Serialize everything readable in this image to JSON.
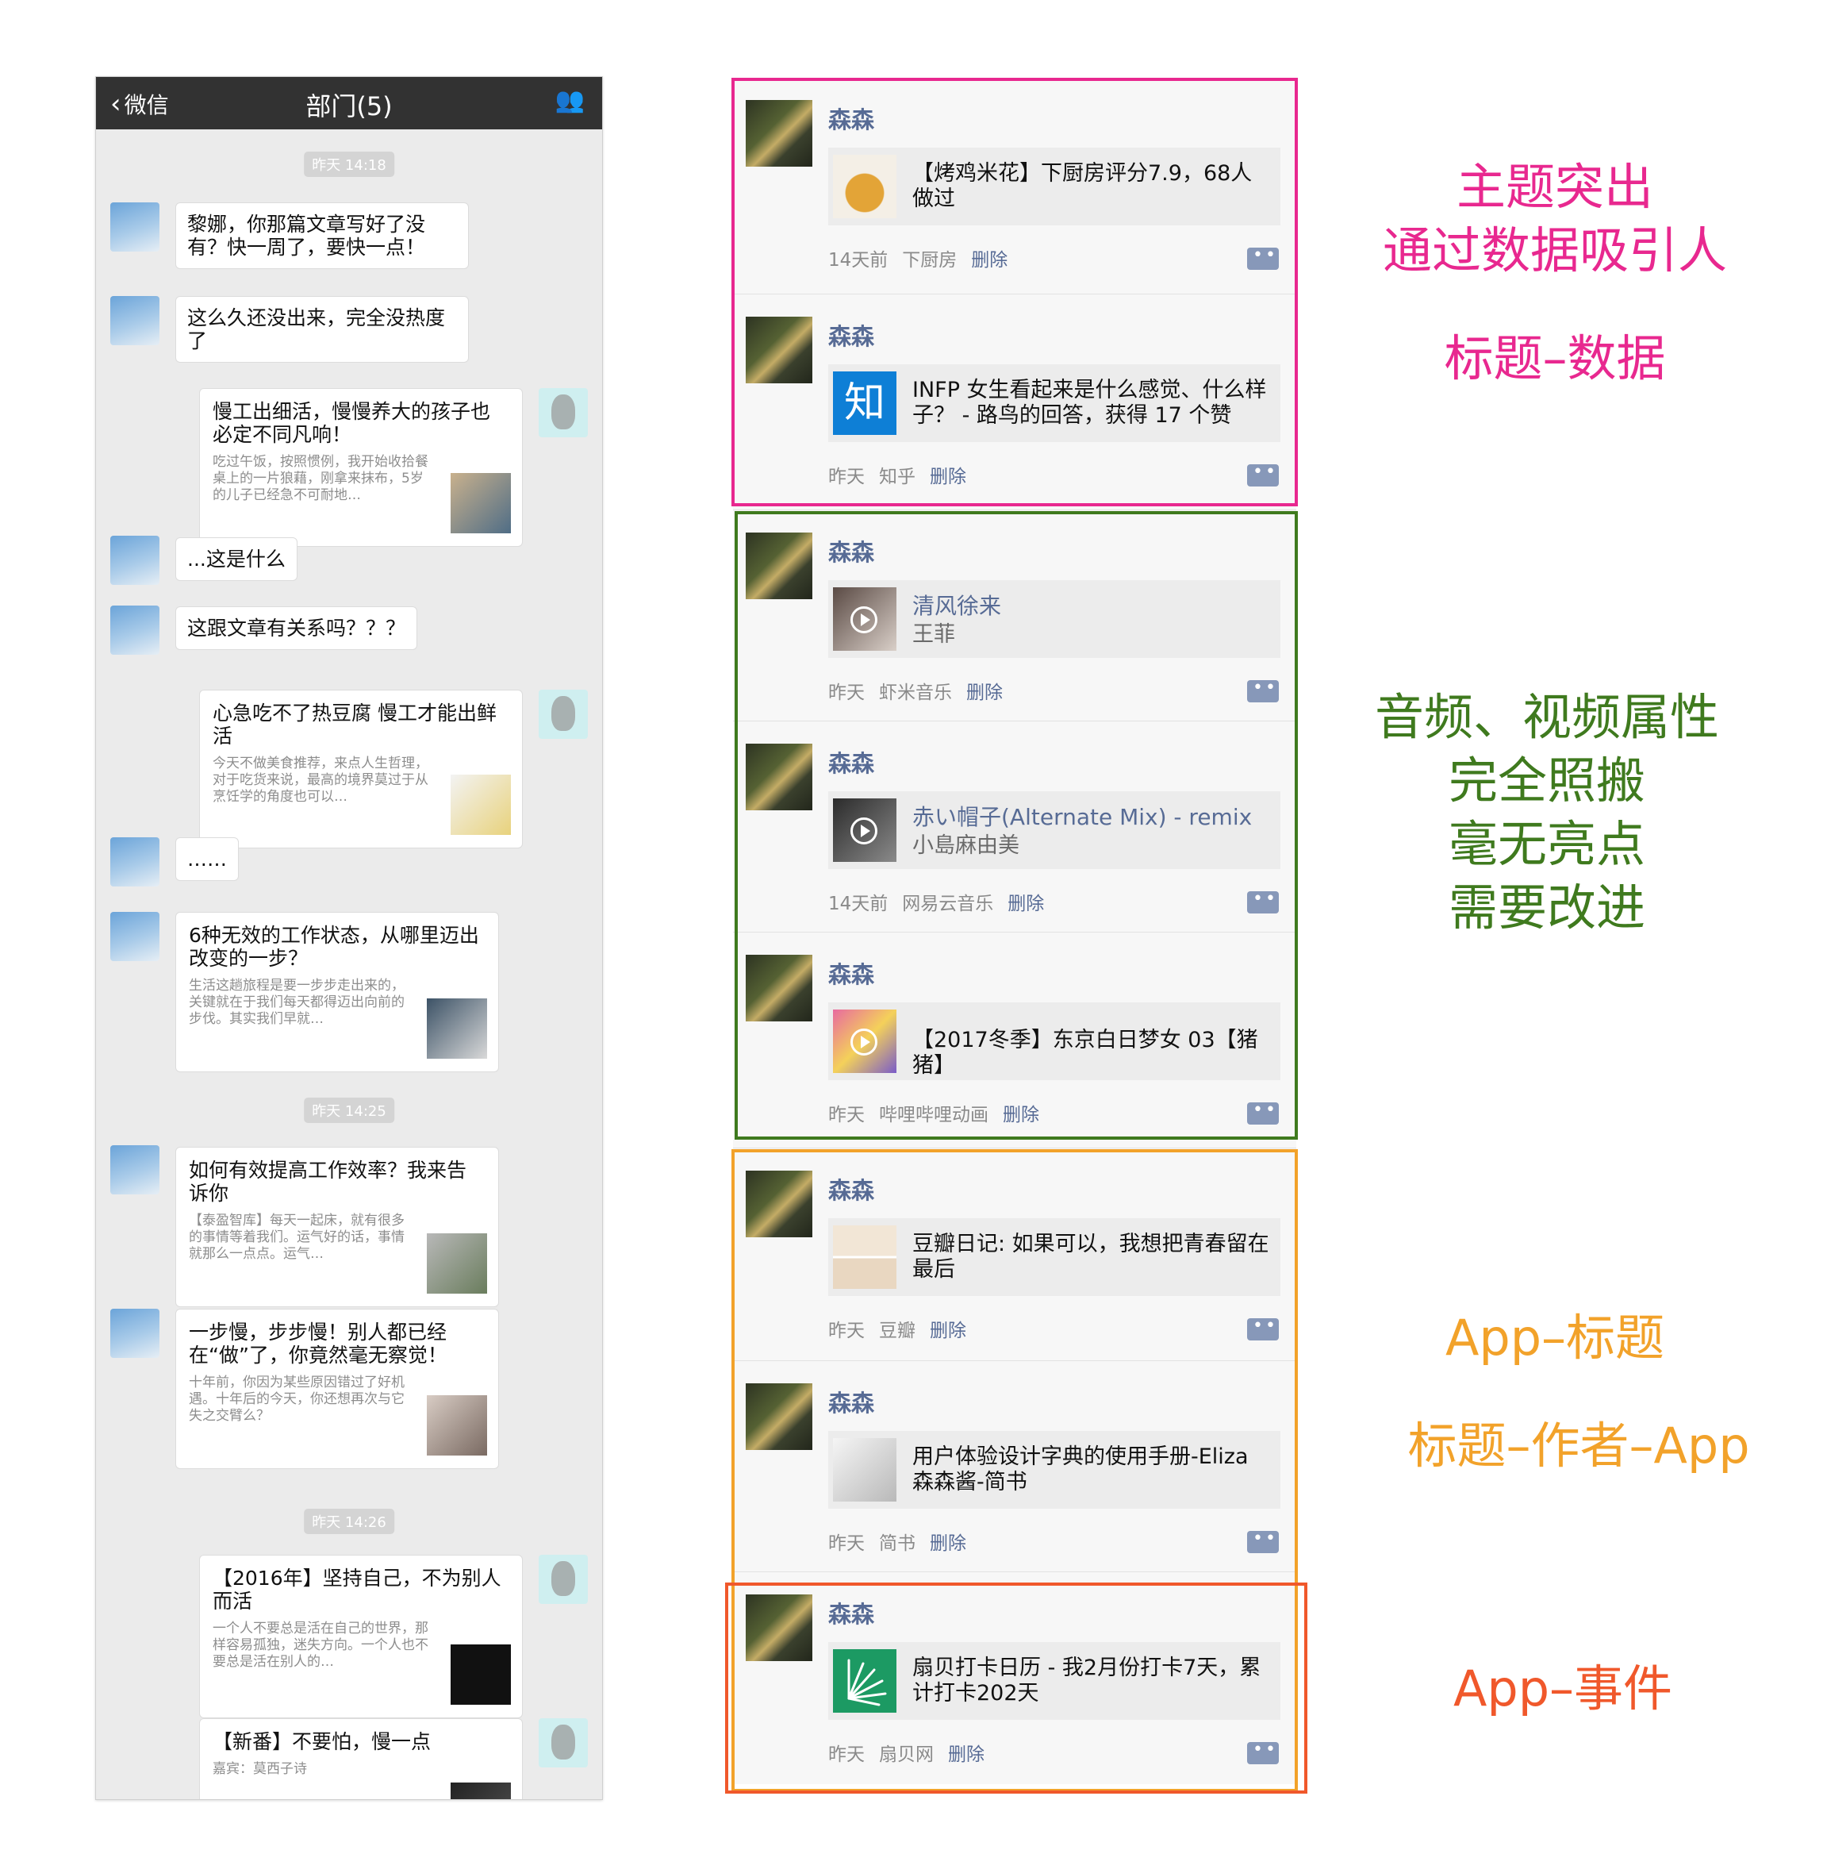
{
  "chat": {
    "back_label": "微信",
    "title": "部门(5)",
    "people_icon": "group-icon",
    "timestamps": [
      "昨天 14:18",
      "昨天 14:25",
      "昨天 14:26"
    ],
    "messages": [
      {
        "text": "黎娜，你那篇文章写好了没有？快一周了，要快一点！"
      },
      {
        "text": "这么久还没出来，完全没热度了"
      },
      {
        "title": "慢工出细活，慢慢养大的孩子也必定不同凡响！",
        "desc": "吃过午饭，按照惯例，我开始收拾餐桌上的一片狼藉，刚拿来抹布，5岁的儿子已经急不可耐地…"
      },
      {
        "text": "...这是什么"
      },
      {
        "text": "这跟文章有关系吗？？？"
      },
      {
        "title": "心急吃不了热豆腐 慢工才能出鲜活",
        "desc": "今天不做美食推荐，来点人生哲理，对于吃货来说，最高的境界莫过于从烹饪学的角度也可以…"
      },
      {
        "text": "……"
      },
      {
        "title": "6种无效的工作状态，从哪里迈出改变的一步？",
        "desc": "生活这趟旅程是要一步步走出来的，关键就在于我们每天都得迈出向前的步伐。其实我们早就…"
      },
      {
        "title": "如何有效提高工作效率？我来告诉你",
        "desc": "【泰盈智库】每天一起床，就有很多的事情等着我们。运气好的话，事情就那么一点点。运气…"
      },
      {
        "title": "一步慢，步步慢！别人都已经在“做”了，你竟然毫无察觉！",
        "desc": "十年前，你因为某些原因错过了好机遇。十年后的今天，你还想再次与它失之交臂么？"
      },
      {
        "title": "【2016年】坚持自己，不为别人而活",
        "desc": "一个人不要总是活在自己的世界，那样容易孤独，迷失方向。一个人也不要总是活在别人的…"
      },
      {
        "title": "【新番】不要怕，慢一点",
        "desc": "嘉宾：莫西子诗"
      }
    ]
  },
  "feed": {
    "items": [
      {
        "name": "森森",
        "text": "【烤鸡米花】下厨房评分7.9，68人做过",
        "time": "14天前",
        "app": "下厨房",
        "delete": "删除"
      },
      {
        "name": "森森",
        "text": "INFP 女生看起来是什么感觉、什么样子？ - 路鸟的回答，获得 17 个赞",
        "time": "昨天",
        "app": "知乎",
        "delete": "删除",
        "icon_text": "知"
      },
      {
        "name": "森森",
        "title": "清风徐来",
        "sub": "王菲",
        "time": "昨天",
        "app": "虾米音乐",
        "delete": "删除"
      },
      {
        "name": "森森",
        "title": "赤い帽子(Alternate Mix) - remix",
        "sub": "小島麻由美",
        "time": "14天前",
        "app": "网易云音乐",
        "delete": "删除"
      },
      {
        "name": "森森",
        "text": "【2017冬季】东京白日梦女 03【猪猪】",
        "time": "昨天",
        "app": "哔哩哔哩动画",
        "delete": "删除"
      },
      {
        "name": "森森",
        "text": "豆瓣日记: 如果可以，我想把青春留在最后",
        "time": "昨天",
        "app": "豆瓣",
        "delete": "删除"
      },
      {
        "name": "森森",
        "text": "用户体验设计字典的使用手册-Eliza森森酱-简书",
        "time": "昨天",
        "app": "简书",
        "delete": "删除"
      },
      {
        "name": "森森",
        "text": "扇贝打卡日历 - 我2月份打卡7天，累计打卡202天",
        "time": "昨天",
        "app": "扇贝网",
        "delete": "删除"
      }
    ]
  },
  "annotations": {
    "pink": [
      "主题突出",
      "通过数据吸引人",
      "标题–数据"
    ],
    "green": [
      "音频、视频属性",
      "完全照搬",
      "毫无亮点",
      "需要改进"
    ],
    "orange": [
      "App–标题",
      "标题–作者–App"
    ],
    "red": [
      "App–事件"
    ]
  },
  "colors": {
    "pink": "#e8288f",
    "green": "#3f7a1e",
    "orange": "#f2a22a",
    "red": "#f0582b",
    "link": "#576b95"
  }
}
